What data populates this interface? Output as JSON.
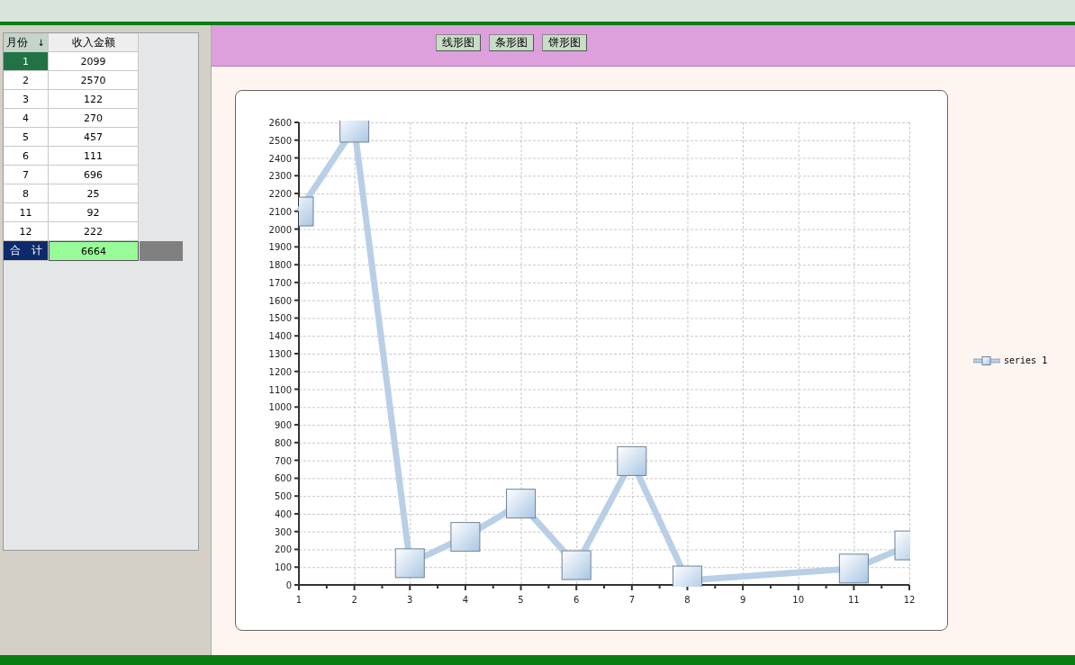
{
  "table": {
    "columns": [
      {
        "label": "月份",
        "sort_icon": "↓"
      },
      {
        "label": "收入金额"
      }
    ],
    "rows": [
      {
        "month": "1",
        "amount": "2099",
        "selected": true
      },
      {
        "month": "2",
        "amount": "2570",
        "selected": false
      },
      {
        "month": "3",
        "amount": "122",
        "selected": false
      },
      {
        "month": "4",
        "amount": "270",
        "selected": false
      },
      {
        "month": "5",
        "amount": "457",
        "selected": false
      },
      {
        "month": "6",
        "amount": "111",
        "selected": false
      },
      {
        "month": "7",
        "amount": "696",
        "selected": false
      },
      {
        "month": "8",
        "amount": "25",
        "selected": false
      },
      {
        "month": "11",
        "amount": "92",
        "selected": false
      },
      {
        "month": "12",
        "amount": "222",
        "selected": false
      }
    ],
    "total": {
      "label": "合　计",
      "amount": "6664"
    }
  },
  "chart_buttons": [
    "线形图",
    "条形图",
    "饼形图"
  ],
  "chart": {
    "chart_data": {
      "type": "line",
      "grid": true,
      "x": [
        1,
        2,
        3,
        4,
        5,
        6,
        7,
        8,
        11,
        12
      ],
      "series": [
        {
          "name": "series 1",
          "color": "#b8cfe6",
          "marker": "square",
          "values": [
            2099,
            2570,
            122,
            270,
            457,
            111,
            696,
            25,
            92,
            222
          ]
        }
      ],
      "xlim": [
        1,
        12
      ],
      "ylim": [
        0,
        2600
      ],
      "xticks": [
        1,
        2,
        3,
        4,
        5,
        6,
        7,
        8,
        9,
        10,
        11,
        12
      ],
      "yticks": [
        0,
        100,
        200,
        300,
        400,
        500,
        600,
        700,
        800,
        900,
        1000,
        1100,
        1200,
        1300,
        1400,
        1500,
        1600,
        1700,
        1800,
        1900,
        2000,
        2100,
        2200,
        2300,
        2400,
        2500,
        2600
      ]
    }
  }
}
